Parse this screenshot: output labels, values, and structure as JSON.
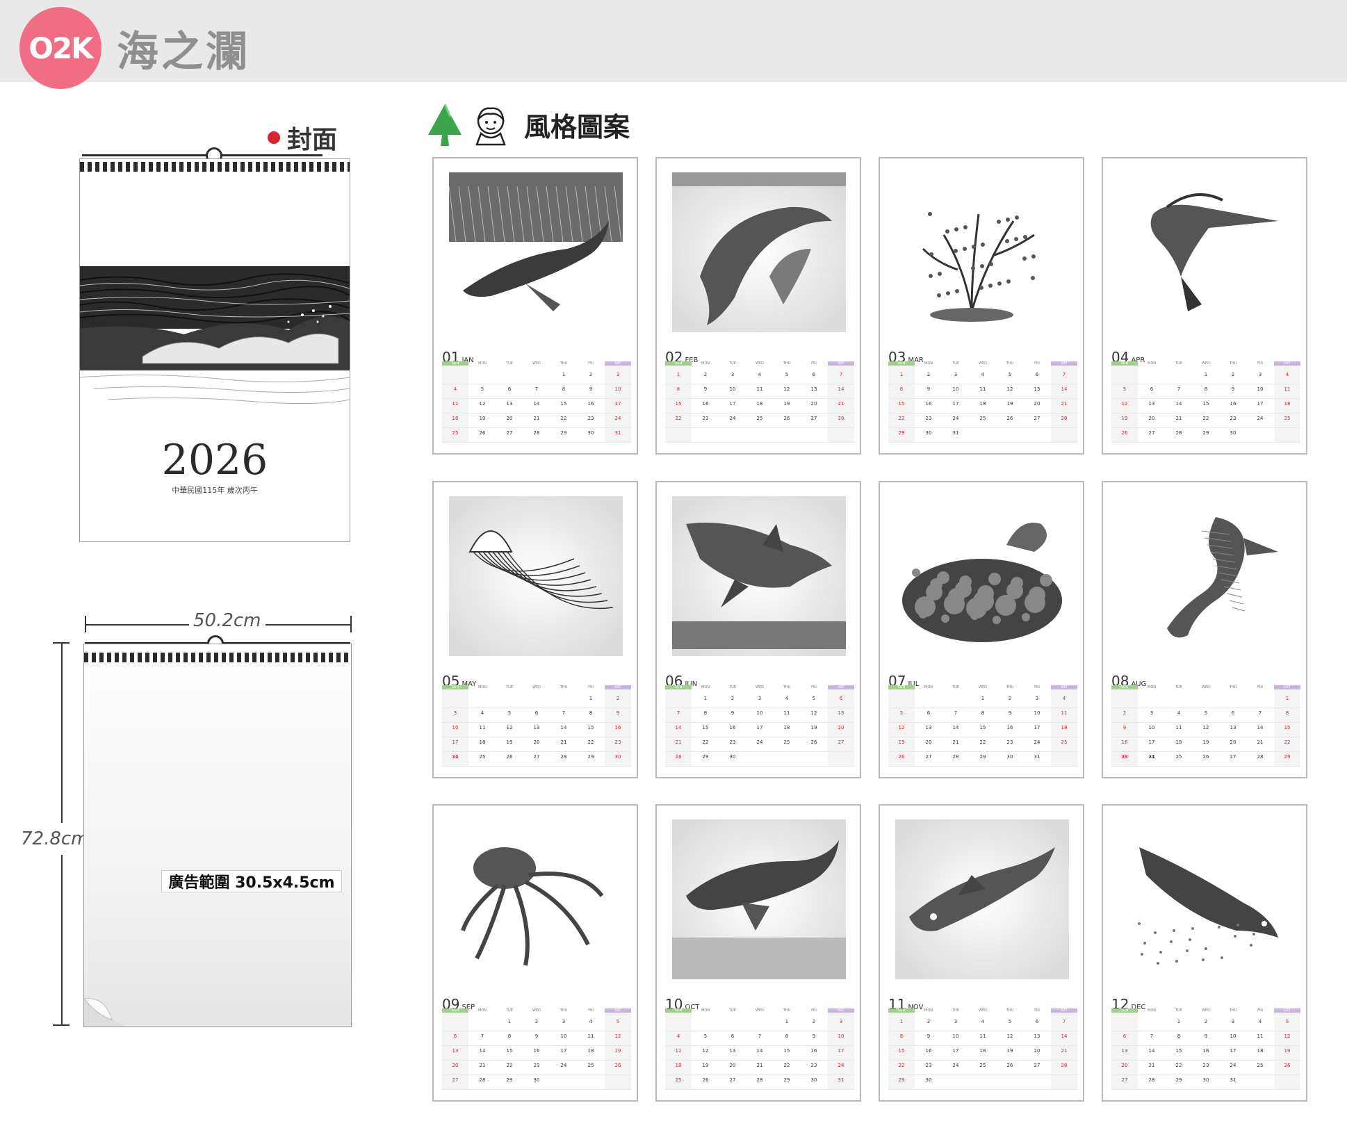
{
  "brand": {
    "badge": "O2K",
    "title": "海之瀾"
  },
  "cover": {
    "label": "封面",
    "year": "2026",
    "subtitle": "中華民國115年 歲次丙午"
  },
  "dimensions": {
    "width": "50.2cm",
    "height": "72.8cm",
    "ad_area": "廣告範圍 30.5x4.5cm"
  },
  "style_section": {
    "label": "風格圖案"
  },
  "weekdays": [
    "SUN",
    "MON",
    "TUE",
    "WED",
    "THU",
    "FRI",
    "SAT"
  ],
  "months": [
    {
      "num": "01",
      "abbr": "JAN",
      "subject": "whale-underwater",
      "start": 4,
      "days": 31
    },
    {
      "num": "02",
      "abbr": "FEB",
      "subject": "dolphins",
      "start": 0,
      "days": 28
    },
    {
      "num": "03",
      "abbr": "MAR",
      "subject": "seaweed",
      "start": 0,
      "days": 31
    },
    {
      "num": "04",
      "abbr": "APR",
      "subject": "marlin",
      "start": 3,
      "days": 30
    },
    {
      "num": "05",
      "abbr": "MAY",
      "subject": "jellyfish",
      "start": 5,
      "days": 31
    },
    {
      "num": "06",
      "abbr": "JUN",
      "subject": "shark",
      "start": 1,
      "days": 30
    },
    {
      "num": "07",
      "abbr": "JUL",
      "subject": "coral-reef",
      "start": 3,
      "days": 31
    },
    {
      "num": "08",
      "abbr": "AUG",
      "subject": "seahorse",
      "start": 6,
      "days": 31
    },
    {
      "num": "09",
      "abbr": "SEP",
      "subject": "octopus",
      "start": 2,
      "days": 30
    },
    {
      "num": "10",
      "abbr": "OCT",
      "subject": "whale",
      "start": 4,
      "days": 31
    },
    {
      "num": "11",
      "abbr": "NOV",
      "subject": "fish",
      "start": 0,
      "days": 30
    },
    {
      "num": "12",
      "abbr": "DEC",
      "subject": "salmon",
      "start": 2,
      "days": 31
    }
  ]
}
